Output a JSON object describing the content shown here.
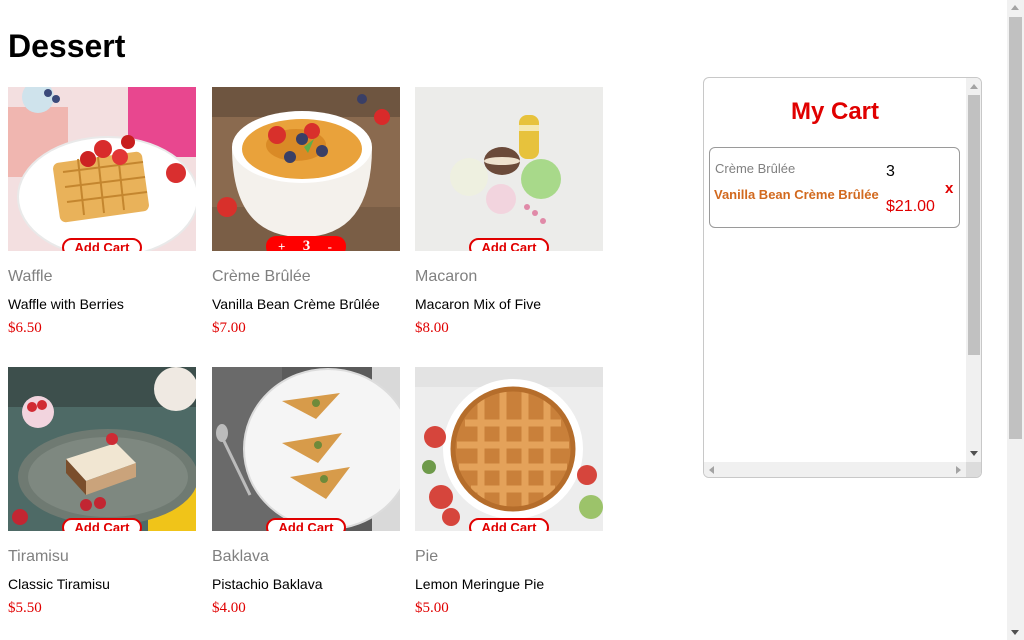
{
  "page": {
    "title": "Dessert"
  },
  "products": [
    {
      "category": "Waffle",
      "name": "Waffle with Berries",
      "price": "$6.50",
      "button_label": "Add Cart",
      "image": "waffle-photo"
    },
    {
      "category": "Crème Brûlée",
      "name": "Vanilla Bean Crème Brûlée",
      "price": "$7.00",
      "in_cart": true,
      "stepper": {
        "plus": "+",
        "qty": "3",
        "minus": "-"
      },
      "image": "creme-brulee-photo"
    },
    {
      "category": "Macaron",
      "name": "Macaron Mix of Five",
      "price": "$8.00",
      "button_label": "Add Cart",
      "image": "macaron-photo"
    },
    {
      "category": "Tiramisu",
      "name": "Classic Tiramisu",
      "price": "$5.50",
      "button_label": "Add Cart",
      "image": "tiramisu-photo"
    },
    {
      "category": "Baklava",
      "name": "Pistachio Baklava",
      "price": "$4.00",
      "button_label": "Add Cart",
      "image": "baklava-photo"
    },
    {
      "category": "Pie",
      "name": "Lemon Meringue Pie",
      "price": "$5.00",
      "button_label": "Add Cart",
      "image": "pie-photo"
    }
  ],
  "cart": {
    "title": "My Cart",
    "items": [
      {
        "category": "Crème Brûlée",
        "name": "Vanilla Bean Crème Brûlée",
        "qty": "3",
        "total": "$21.00",
        "remove_label": "x"
      }
    ]
  },
  "colors": {
    "accent": "#e00000",
    "cart_item_name": "#d2691e",
    "muted": "#808080"
  }
}
